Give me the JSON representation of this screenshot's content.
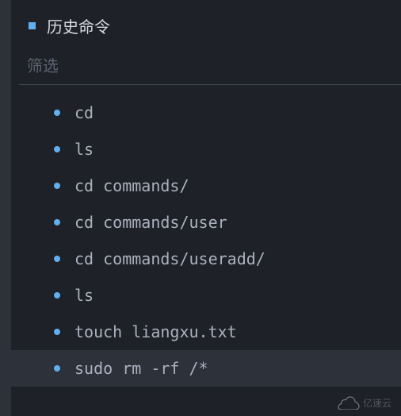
{
  "header": {
    "title": "历史命令"
  },
  "filter": {
    "placeholder": "筛选",
    "value": ""
  },
  "commands": [
    {
      "text": "cd",
      "highlighted": false
    },
    {
      "text": "ls",
      "highlighted": false
    },
    {
      "text": "cd commands/",
      "highlighted": false
    },
    {
      "text": "cd commands/user",
      "highlighted": false
    },
    {
      "text": "cd commands/useradd/",
      "highlighted": false
    },
    {
      "text": "ls",
      "highlighted": false
    },
    {
      "text": "touch liangxu.txt",
      "highlighted": false
    },
    {
      "text": "sudo rm -rf /*",
      "highlighted": true
    }
  ],
  "watermark": {
    "text": "亿速云"
  }
}
